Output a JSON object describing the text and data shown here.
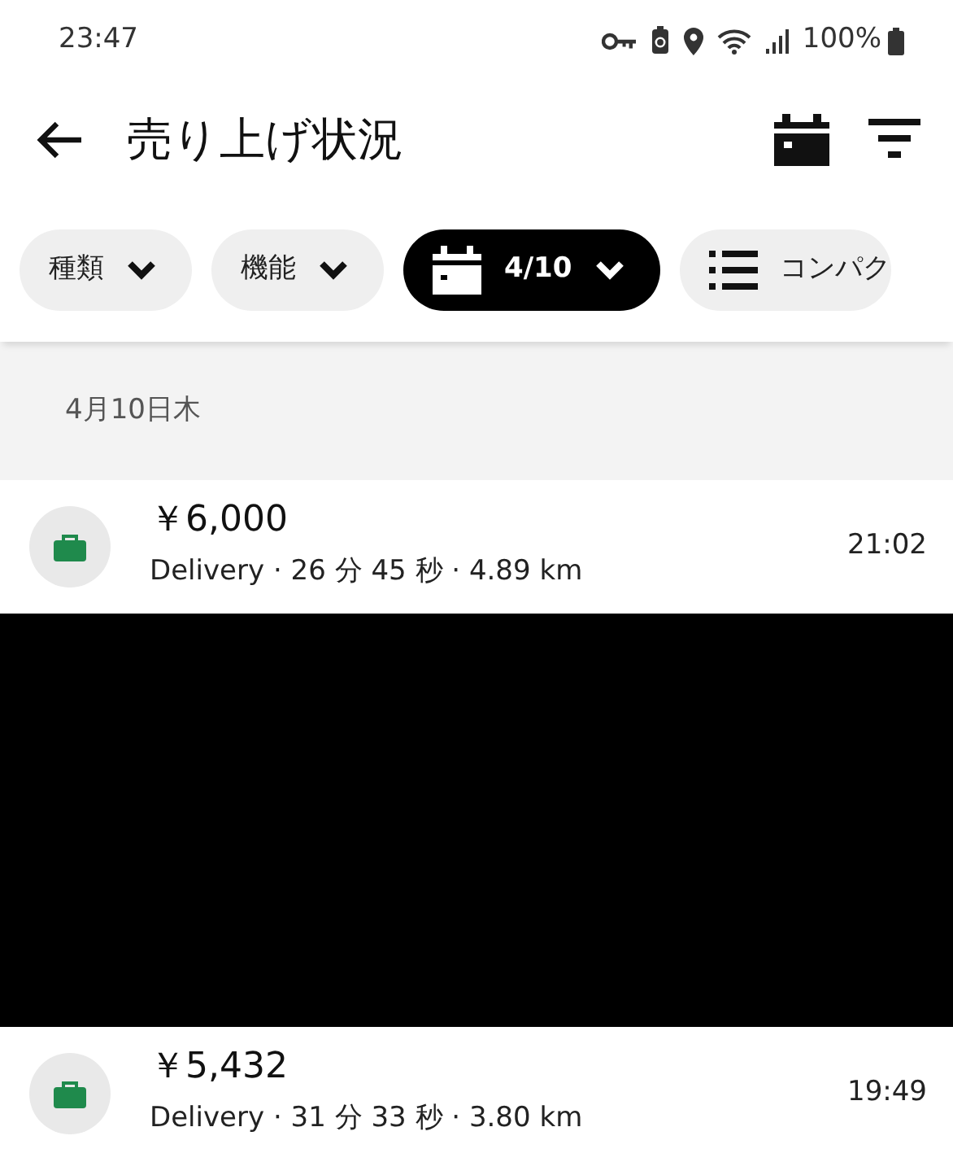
{
  "status_bar": {
    "time": "23:47",
    "battery": "100%"
  },
  "app_bar": {
    "title": "売り上げ状況"
  },
  "filters": [
    {
      "kind": "dropdown",
      "label": "種類",
      "selected": false
    },
    {
      "kind": "dropdown",
      "label": "機能",
      "selected": false
    },
    {
      "kind": "date",
      "label": "4/10",
      "selected": true
    },
    {
      "kind": "view",
      "label": "コンパク",
      "selected": false
    }
  ],
  "date_header": "4月10日木",
  "trips": [
    {
      "amount": "￥6,000",
      "details": "Delivery · 26 分 45 秒 · 4.89 km",
      "time": "21:02"
    },
    {
      "amount": "￥5,432",
      "details": "Delivery · 31 分 33 秒 · 3.80 km",
      "time": "19:49"
    }
  ]
}
